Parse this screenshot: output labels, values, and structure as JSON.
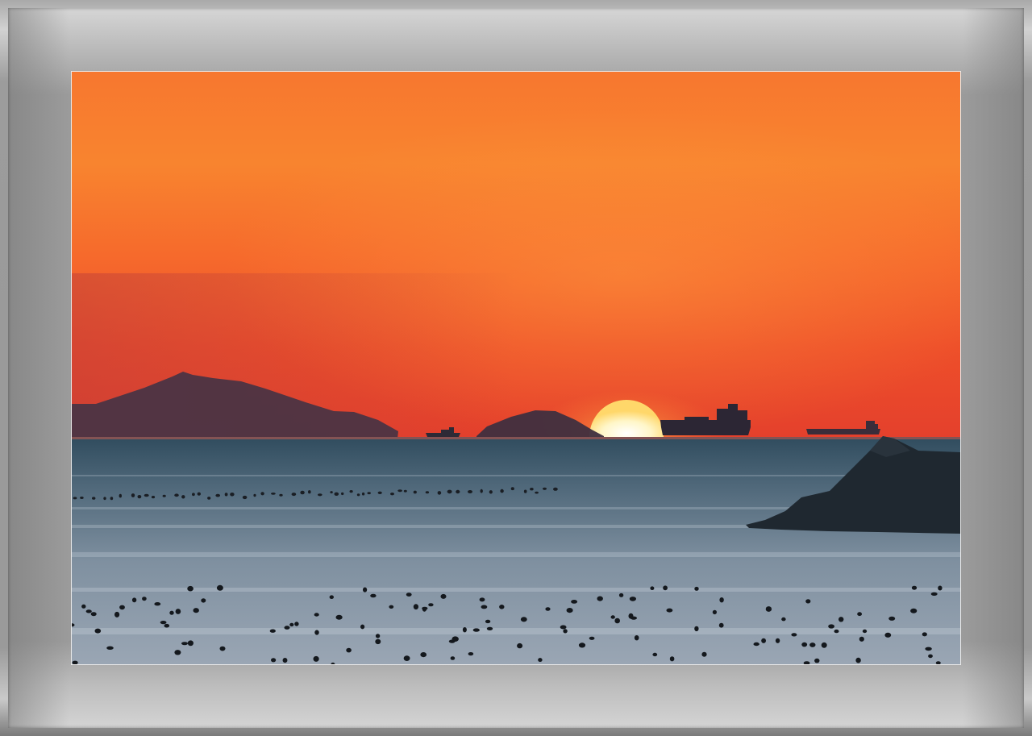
{
  "scene": {
    "subject": "sunset-over-sea",
    "colors": {
      "sky_top": "#f77b2e",
      "sky_mid": "#f8822e",
      "sky_low": "#e5452a",
      "horizon": "#e0402c",
      "sun": "#fff9d8",
      "silhouette": "#3e3040",
      "sea_top": "#2f4b5c",
      "sea_bottom": "#9aa8b6",
      "rock": "#1f2a33",
      "frame": "#9b9b9b"
    }
  }
}
